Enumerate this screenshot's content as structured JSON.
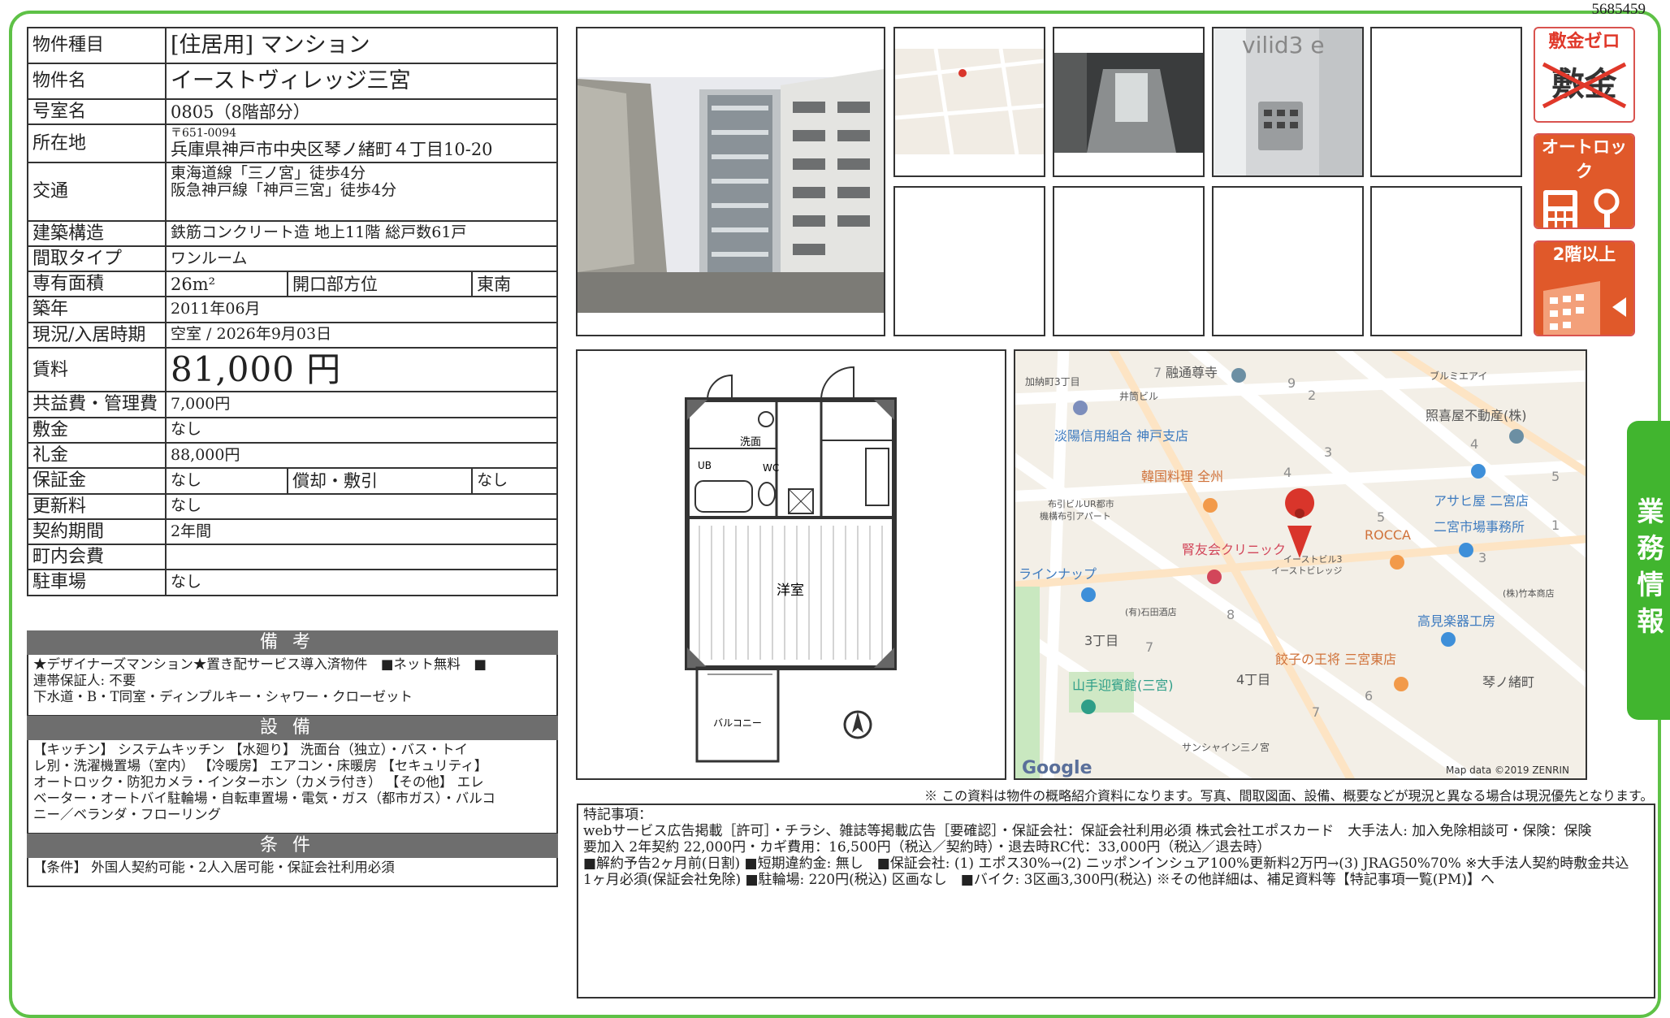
{
  "doc_id": "5685459",
  "info": {
    "type_label": "物件種目",
    "type_value": "[住居用] マンション",
    "name_label": "物件名",
    "name_value": "イーストヴィレッジ三宮",
    "room_label": "号室名",
    "room_value": "0805（8階部分）",
    "address_label": "所在地",
    "zip": "〒651-0094",
    "address_value": "兵庫県神戸市中央区琴ノ緒町４丁目10-20",
    "transport_label": "交通",
    "transport_1": "東海道線「三ノ宮」徒歩4分",
    "transport_2": "阪急神戸線「神戸三宮」徒歩4分",
    "structure_label": "建築構造",
    "structure_value": "鉄筋コンクリート造 地上11階 総戸数61戸",
    "layout_label": "間取タイプ",
    "layout_value": "ワンルーム",
    "area_label": "専有面積",
    "area_value": "26m²",
    "direction_label": "開口部方位",
    "direction_value": "東南",
    "built_label": "築年",
    "built_value": "2011年06月",
    "status_label": "現況/入居時期",
    "status_value": "空室 /  2026年9月03日",
    "rent_label": "賃料",
    "rent_value": "81,000 円",
    "fee_label": "共益費・管理費",
    "fee_value": "7,000円",
    "deposit_label": "敷金",
    "deposit_value": "なし",
    "key_money_label": "礼金",
    "key_money_value": "88,000円",
    "guarantee_label": "保証金",
    "guarantee_value": "なし",
    "amort_label": "償却・敷引",
    "amort_value": "なし",
    "renewal_label": "更新料",
    "renewal_value": "なし",
    "contract_label": "契約期間",
    "contract_value": "2年間",
    "community_label": "町内会費",
    "community_value": "",
    "parking_label": "駐車場",
    "parking_value": "なし"
  },
  "remarks": {
    "title": "備考",
    "text": "★デザイナーズマンション★置き配サービス導入済物件　■ネット無料　■\n連帯保証人: 不要\n下水道・B・T同室・ディンプルキー・シャワー・クローゼット"
  },
  "facilities": {
    "title": "設備",
    "text": "【キッチン】 システムキッチン 【水廻り】 洗面台（独立）・バス・トイ\nレ別・洗濯機置場（室内） 【冷暖房】 エアコン・床暖房 【セキュリティ】\nオートロック・防犯カメラ・インターホン（カメラ付き） 【その他】 エレ\nベーター・オートバイ駐輪場・自転車置場・電気・ガス（都市ガス）・バルコ\nニー／ベランダ・フローリング"
  },
  "conditions": {
    "title": "条件",
    "text": "【条件】 外国人契約可能・2人入居可能・保証会社利用必須"
  },
  "badges": {
    "zero_deposit": "敷金ゼロ",
    "zero_deposit_strike": "敷金",
    "autolock": "オートロック",
    "second_floor": "2階以上"
  },
  "side_tab": "業務情報",
  "floorplan": {
    "washroom": "洗面",
    "ub": "UB",
    "wc": "WC",
    "room": "洋室",
    "balcony": "バルコニー"
  },
  "photo_sign": "vilid3 e",
  "map": {
    "labels": [
      {
        "t": "加納町3丁目"
      },
      {
        "t": "融通尊寺"
      },
      {
        "t": "井筒ビル"
      },
      {
        "t": "ブルミエアイ"
      },
      {
        "t": "照喜屋不動産(株)"
      },
      {
        "t": "淡陽信用組合 神戸支店"
      },
      {
        "t": "韓国料理 全州"
      },
      {
        "t": "布引ビルUR都市"
      },
      {
        "t": "機構布引アパート"
      },
      {
        "t": "アサヒ屋 二宮店"
      },
      {
        "t": "二宮市場事務所"
      },
      {
        "t": "ROCCA"
      },
      {
        "t": "腎友会クリニック"
      },
      {
        "t": "イーストビル3"
      },
      {
        "t": "イーストビレッジ"
      },
      {
        "t": "ラインナップ"
      },
      {
        "t": "(有)石田酒店"
      },
      {
        "t": "(株)竹本商店"
      },
      {
        "t": "高見楽器工房"
      },
      {
        "t": "3丁目"
      },
      {
        "t": "餃子の王将 三宮東店"
      },
      {
        "t": "4丁目"
      },
      {
        "t": "琴ノ緒町"
      },
      {
        "t": "山手迎賓館(三宮)"
      },
      {
        "t": "サンシャイン三ノ宮"
      }
    ],
    "numbers": [
      "7",
      "9",
      "2",
      "4",
      "3",
      "5",
      "4",
      "5",
      "3",
      "8",
      "7",
      "6",
      "7",
      "1"
    ],
    "google": "Google",
    "credit": "Map data ©2019 ZENRIN"
  },
  "notice": "※ この資料は物件の概略紹介資料になります。写真、間取図面、設備、概要などが現況と異なる場合は現況優先となります。",
  "special": {
    "text": "特記事項：\nwebサービス広告掲載［許可］・チラシ、雑誌等掲載広告［要確認］・保証会社：保証会社利用必須 株式会社エポスカード　大手法人: 加入免除相談可・保険：保険\n要加入 2年契約 22,000円・カギ費用：16,500円（税込／契約時）・退去時RC代：33,000円（税込／退去時）\n■解約予告2ヶ月前(日割) ■短期違約金: 無し　■保証会社: (1) エポス30%→(2) ニッポンインシュア100%更新料2万円→(3) JRAG50%70% ※大手法人契約時敷金共込\n1ヶ月必須(保証会社免除) ■駐輪場: 220円(税込) 区画なし　■バイク: 3区画3,300円(税込) ※その他詳細は、補足資料等【特記事項一覧(PM)】へ"
  }
}
